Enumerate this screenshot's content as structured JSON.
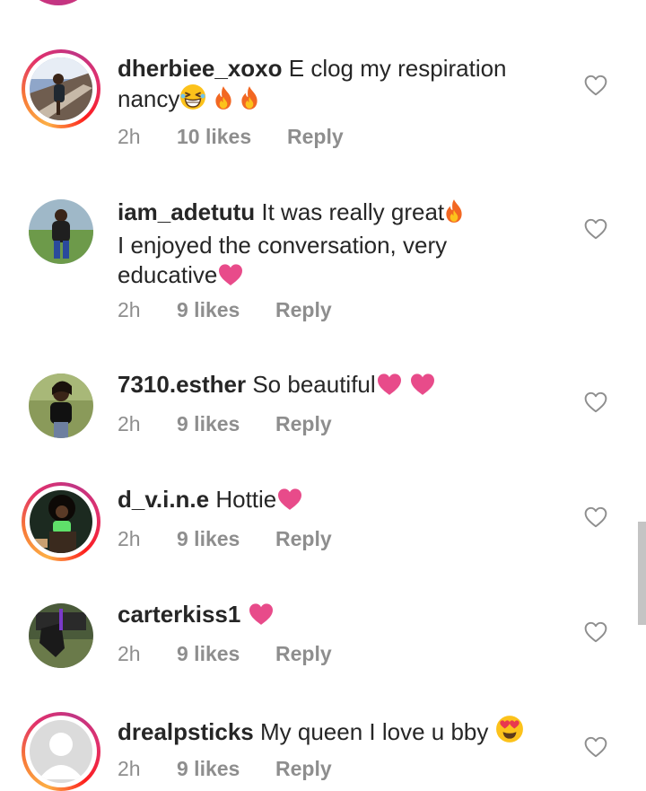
{
  "comments": [
    {
      "username": "dherbiee_xoxo",
      "text": "E clog my respiration nancy",
      "emojis": [
        "grinning-squinting-face-icon",
        "fire-icon",
        "fire-icon"
      ],
      "time": "2h",
      "likes": "10 likes",
      "reply": "Reply",
      "story_ring": true
    },
    {
      "username": "iam_adetutu",
      "text_line1": "It was really great",
      "text_line2": "I enjoyed the conversation, very",
      "text_line3": "educative",
      "emojis": [
        "fire-icon",
        "pink-heart-icon"
      ],
      "time": "2h",
      "likes": "9 likes",
      "reply": "Reply",
      "story_ring": false
    },
    {
      "username": "7310.esther",
      "text": "So beautiful",
      "emojis": [
        "pink-heart-icon",
        "pink-heart-icon"
      ],
      "time": "2h",
      "likes": "9 likes",
      "reply": "Reply",
      "story_ring": false
    },
    {
      "username": "d_v.i.n.e",
      "text": "Hottie",
      "emojis": [
        "pink-heart-icon"
      ],
      "time": "2h",
      "likes": "9 likes",
      "reply": "Reply",
      "story_ring": true
    },
    {
      "username": "carterkiss1",
      "text": "",
      "emojis": [
        "pink-heart-icon"
      ],
      "time": "2h",
      "likes": "9 likes",
      "reply": "Reply",
      "story_ring": false
    },
    {
      "username": "drealpsticks",
      "text": "My queen I love u bby",
      "emojis": [
        "smiling-face-with-heart-eyes-icon"
      ],
      "time": "2h",
      "likes": "9 likes",
      "reply": "Reply",
      "story_ring": true
    }
  ],
  "colors": {
    "text": "#262626",
    "meta": "#8e8e8e",
    "heart_emoji": "#e84b8a",
    "story_ring": [
      "#fcaf45",
      "#e1306c",
      "#c13584"
    ]
  }
}
